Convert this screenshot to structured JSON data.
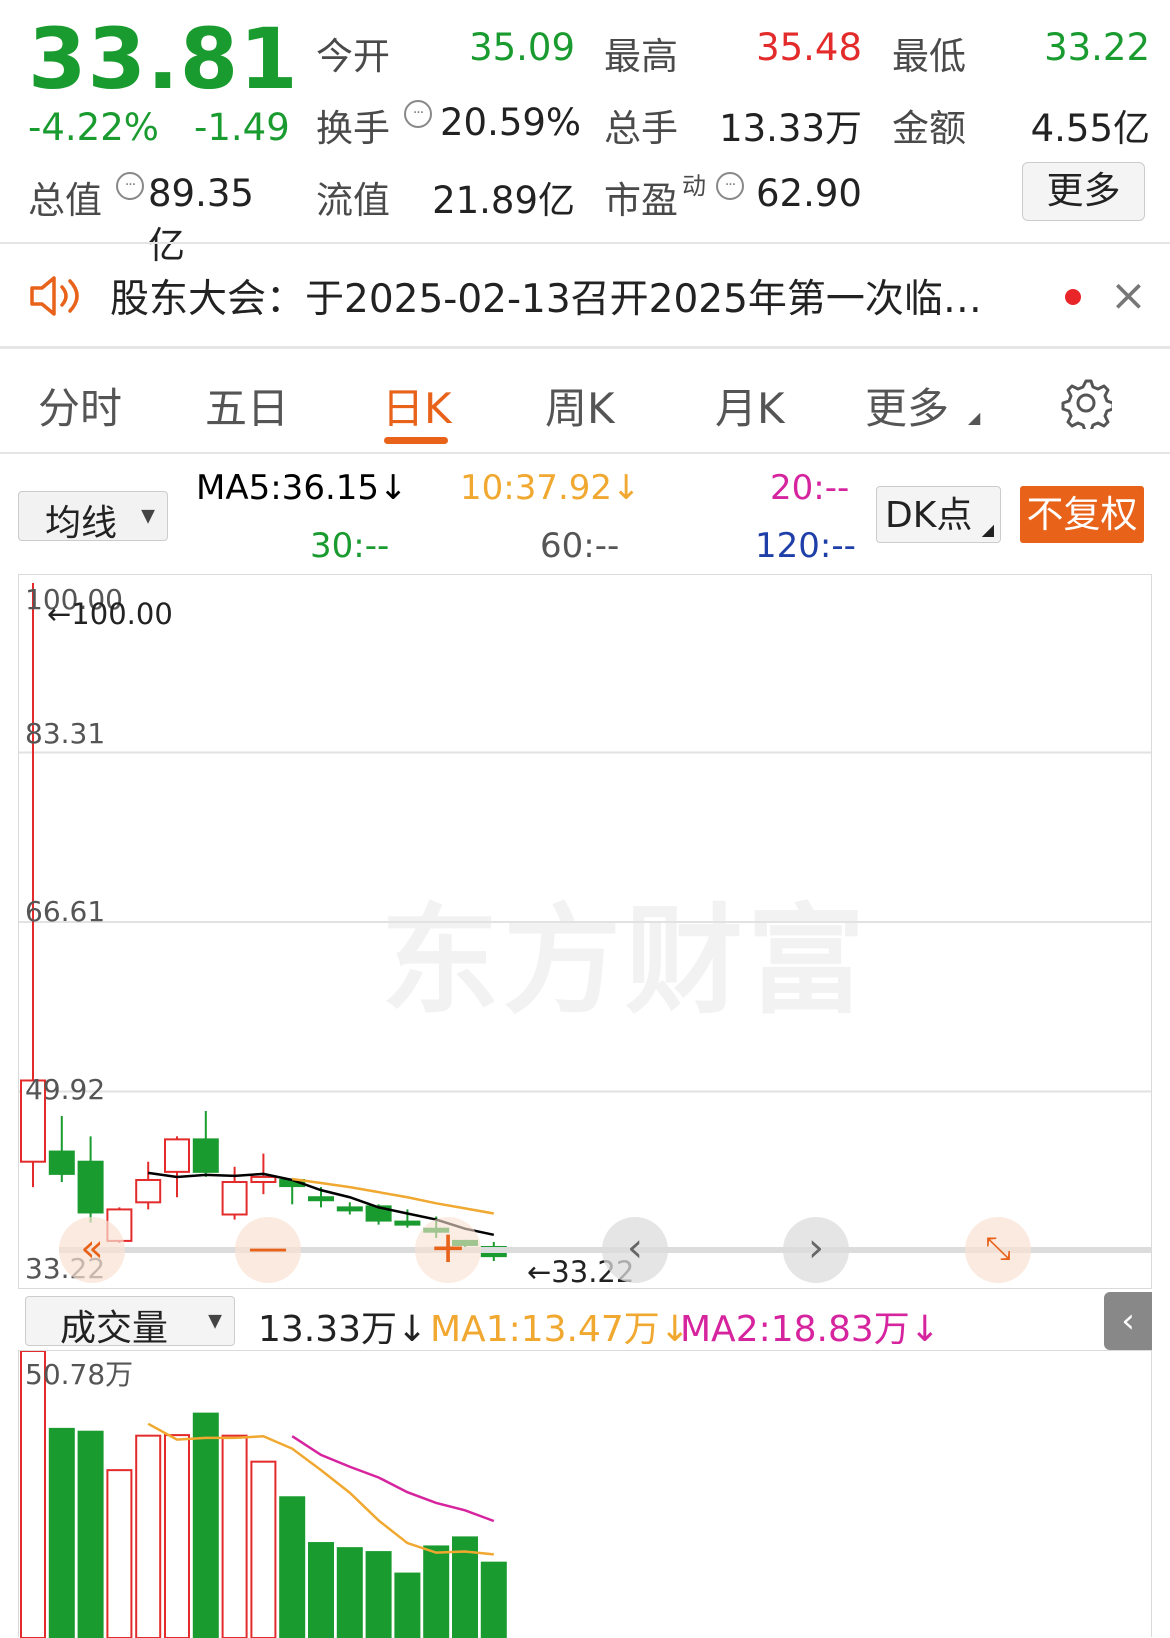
{
  "quote": {
    "price": "33.81",
    "change_pct": "-4.22%",
    "change_abs": "-1.49",
    "open_label": "今开",
    "open_val": "35.09",
    "high_label": "最高",
    "high_val": "35.48",
    "low_label": "最低",
    "low_val": "33.22",
    "turnover_label": "换手",
    "turnover_val": "20.59%",
    "volume_label": "总手",
    "volume_val": "13.33万",
    "amount_label": "金额",
    "amount_val": "4.55亿",
    "mktcap_label": "总值",
    "mktcap_val": "89.35亿",
    "float_label": "流值",
    "float_val": "21.89亿",
    "pe_label": "市盈",
    "pe_sup": "动",
    "pe_val": "62.90",
    "more_label": "更多"
  },
  "notice": {
    "text": "股东大会：于2025-02-13召开2025年第一次临…",
    "close_glyph": "×"
  },
  "tabs": [
    {
      "label": "分时",
      "active": false
    },
    {
      "label": "五日",
      "active": false
    },
    {
      "label": "日K",
      "active": true
    },
    {
      "label": "周K",
      "active": false
    },
    {
      "label": "月K",
      "active": false
    },
    {
      "label": "更多",
      "active": false
    }
  ],
  "indicator_bar": {
    "select_label": "均线",
    "ma5": "MA5:36.15↓",
    "ma10": "10:37.92↓",
    "ma20": "20:--",
    "ma30": "30:--",
    "ma60": "60:--",
    "ma120": "120:--",
    "dk_label": "DK点",
    "rights_label": "不复权"
  },
  "price_axis": {
    "labels": [
      "100.00",
      "83.31",
      "66.61",
      "49.92",
      "33.22"
    ],
    "max_marker": "←100.00",
    "min_marker": "←33.22"
  },
  "watermark": "东方财富",
  "volume_bar": {
    "select_label": "成交量",
    "volume": "13.33万↓",
    "ma1": "MA1:13.47万↓",
    "ma2": "MA2:18.83万↓",
    "axis_max": "50.78万"
  },
  "colors": {
    "up": "#e32b2b",
    "down": "#1a9b2f",
    "accent": "#e8621a",
    "ma5": "#000000",
    "ma10": "#f0a830",
    "ma20": "#d6249f",
    "ma30": "#1a9b2f",
    "ma120": "#1f3fa8"
  },
  "chart_data": {
    "type": "candlestick",
    "ylim": [
      33.22,
      100.0
    ],
    "candles": [
      {
        "o": 43.0,
        "c": 51.0,
        "h": 100.0,
        "l": 40.5
      },
      {
        "o": 44.0,
        "c": 41.8,
        "h": 47.5,
        "l": 41.0
      },
      {
        "o": 43.0,
        "c": 38.0,
        "h": 45.5,
        "l": 37.0
      },
      {
        "o": 35.2,
        "c": 38.3,
        "h": 38.5,
        "l": 35.0
      },
      {
        "o": 39.0,
        "c": 41.2,
        "h": 43.0,
        "l": 38.3
      },
      {
        "o": 42.0,
        "c": 45.2,
        "h": 45.5,
        "l": 39.5
      },
      {
        "o": 45.2,
        "c": 42.0,
        "h": 48.0,
        "l": 41.5
      },
      {
        "o": 37.8,
        "c": 41.0,
        "h": 42.5,
        "l": 37.3
      },
      {
        "o": 41.0,
        "c": 41.5,
        "h": 43.8,
        "l": 39.8
      },
      {
        "o": 41.2,
        "c": 40.6,
        "h": 41.3,
        "l": 38.8
      },
      {
        "o": 39.5,
        "c": 39.3,
        "h": 40.5,
        "l": 38.5
      },
      {
        "o": 38.5,
        "c": 38.4,
        "h": 39.0,
        "l": 37.8
      },
      {
        "o": 38.6,
        "c": 37.2,
        "h": 38.8,
        "l": 36.8
      },
      {
        "o": 37.1,
        "c": 37.0,
        "h": 38.3,
        "l": 36.5
      },
      {
        "o": 36.4,
        "c": 36.3,
        "h": 37.6,
        "l": 35.5
      },
      {
        "o": 35.2,
        "c": 34.8,
        "h": 35.3,
        "l": 34.3
      },
      {
        "o": 34.6,
        "c": 33.7,
        "h": 35.1,
        "l": 33.22
      }
    ],
    "ma5": [
      null,
      null,
      null,
      null,
      41.9,
      41.5,
      41.7,
      41.6,
      41.8,
      41.2,
      40.2,
      39.5,
      38.5,
      37.9,
      37.3,
      36.4,
      35.8
    ],
    "ma10": [
      null,
      null,
      null,
      null,
      null,
      null,
      null,
      null,
      null,
      41.3,
      40.9,
      40.5,
      40.0,
      39.5,
      38.9,
      38.4,
      37.9
    ],
    "volume": {
      "unit": "万",
      "ylim": [
        0,
        50.78
      ],
      "values": [
        50.78,
        37.0,
        36.5,
        29.7,
        35.8,
        35.9,
        39.7,
        35.8,
        31.2,
        24.9,
        16.8,
        15.9,
        15.2,
        11.4,
        16.2,
        17.8,
        13.33
      ],
      "ma1": [
        null,
        null,
        null,
        null,
        37.9,
        35.1,
        35.4,
        35.4,
        35.7,
        33.5,
        29.7,
        25.7,
        20.8,
        16.8,
        15.1,
        15.3,
        14.8
      ],
      "ma2": [
        null,
        null,
        null,
        null,
        null,
        null,
        null,
        null,
        null,
        35.7,
        32.4,
        30.3,
        28.4,
        25.8,
        23.9,
        22.6,
        20.7
      ]
    }
  }
}
